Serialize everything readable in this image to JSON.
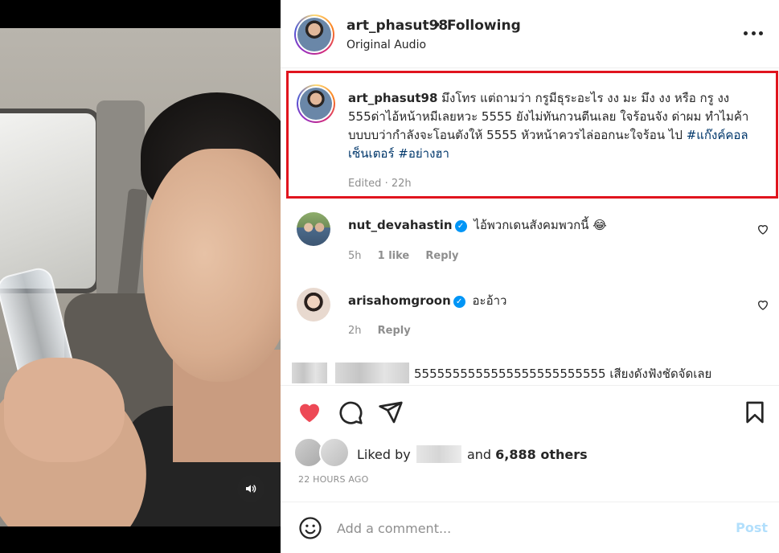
{
  "post": {
    "username": "art_phasut98",
    "separator": "•",
    "follow_status": "Following",
    "audio": "Original Audio"
  },
  "caption": {
    "username": "art_phasut98",
    "text": "มึงโทร แต่ถามว่า กรูมีธุระอะไร งง มะ มึง งง หรือ กรู งง 555ด่าไอ้หน้าหมีเลยหวะ 5555 ยังไม่ทันกวนตีนเลย ใจร้อนจัง ด่าผม ทำไมค้าบบบบว่ากำลังจะโอนตังให้ 5555 หัวหน้าควรไล่ออกนะใจร้อน ไป",
    "hashtags": [
      "#แก๊งค์คอลเซ็นเตอร์",
      "#อย่างฮา"
    ],
    "edited": "Edited",
    "meta_sep": "·",
    "time": "22h"
  },
  "comments": [
    {
      "username": "nut_devahastin",
      "verified": "✓",
      "text": "ไอ้พวกเดนสังคมพวกนี้ 😂",
      "time": "5h",
      "likes": "1 like",
      "reply": "Reply"
    },
    {
      "username": "arisahomgroon",
      "verified": "✓",
      "text": "อะอ้าว",
      "time": "2h",
      "reply": "Reply"
    }
  ],
  "partial_comment": {
    "text": "5555555555555555555555555 เสียงดังฟังชัดจัดเลย"
  },
  "likes": {
    "prefix": "Liked by",
    "middle": "and",
    "count": "6,888 others"
  },
  "timestamp": "22 HOURS AGO",
  "add_comment": {
    "placeholder": "Add a comment...",
    "post_label": "Post"
  },
  "colors": {
    "like_red": "#ed4956",
    "highlight_box": "#e0141e",
    "hashtag": "#00376b",
    "verified": "#0095f6",
    "post_disabled": "#b2dffc"
  },
  "icons": [
    "volume-icon",
    "more-icon",
    "heart-icon",
    "comment-icon",
    "share-icon",
    "save-icon",
    "emoji-icon"
  ]
}
